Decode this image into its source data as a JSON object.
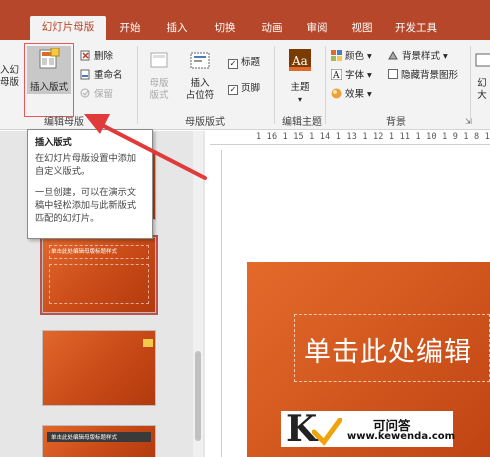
{
  "tabs": [
    {
      "label": "幻灯片母版",
      "active": true
    },
    {
      "label": "开始",
      "active": false
    },
    {
      "label": "插入",
      "active": false
    },
    {
      "label": "切换",
      "active": false
    },
    {
      "label": "动画",
      "active": false
    },
    {
      "label": "审阅",
      "active": false
    },
    {
      "label": "视图",
      "active": false
    },
    {
      "label": "开发工具",
      "active": false
    }
  ],
  "ribbon": {
    "edit_master": {
      "insert_slide_master_partial": "入幻",
      "insert_slide_master_partial2": "母版",
      "insert_layout": "插入版式",
      "delete": "删除",
      "rename": "重命名",
      "preserve": "保留",
      "group_label": "编辑母版"
    },
    "master_layout": {
      "master_layout_btn": "母版",
      "master_layout_btn2": "版式",
      "insert_placeholder": "插入",
      "insert_placeholder2": "占位符",
      "title_check": "标题",
      "footer_check": "页脚",
      "group_label": "母版版式"
    },
    "edit_theme": {
      "themes": "主题",
      "group_label": "编辑主题"
    },
    "background": {
      "colors": "颜色",
      "fonts": "字体",
      "effects": "效果",
      "background_styles": "背景样式",
      "hide_background_graphics": "隐藏背景图形",
      "group_label": "背景"
    },
    "size_partial": "幻",
    "size_partial2": "大"
  },
  "ruler_text": "1 16 1 15 1 14 1 13 1 12 1 11 1 10 1 9 1 8 1 7 1",
  "tooltip": {
    "title": "插入版式",
    "line1": "在幻灯片母版设置中添加自定义版式。",
    "line2": "一旦创建，可以在演示文稿中轻松添加与此新版式匹配的幻灯片。"
  },
  "slide": {
    "title_placeholder": "单击此处编辑"
  },
  "thumbnails": [
    {
      "label": "",
      "selected": false
    },
    {
      "label": "单击此处编辑母版标题样式",
      "selected": true
    },
    {
      "label": "",
      "selected": false
    },
    {
      "label": "单击此处编辑母版标题样式",
      "selected": false
    }
  ],
  "watermark": {
    "letter": "K",
    "name": "可问答",
    "url": "www.kewenda.com"
  },
  "colors": {
    "accent": "#b7472a",
    "slide": "#d45a20",
    "arrow": "#e03a3a"
  }
}
